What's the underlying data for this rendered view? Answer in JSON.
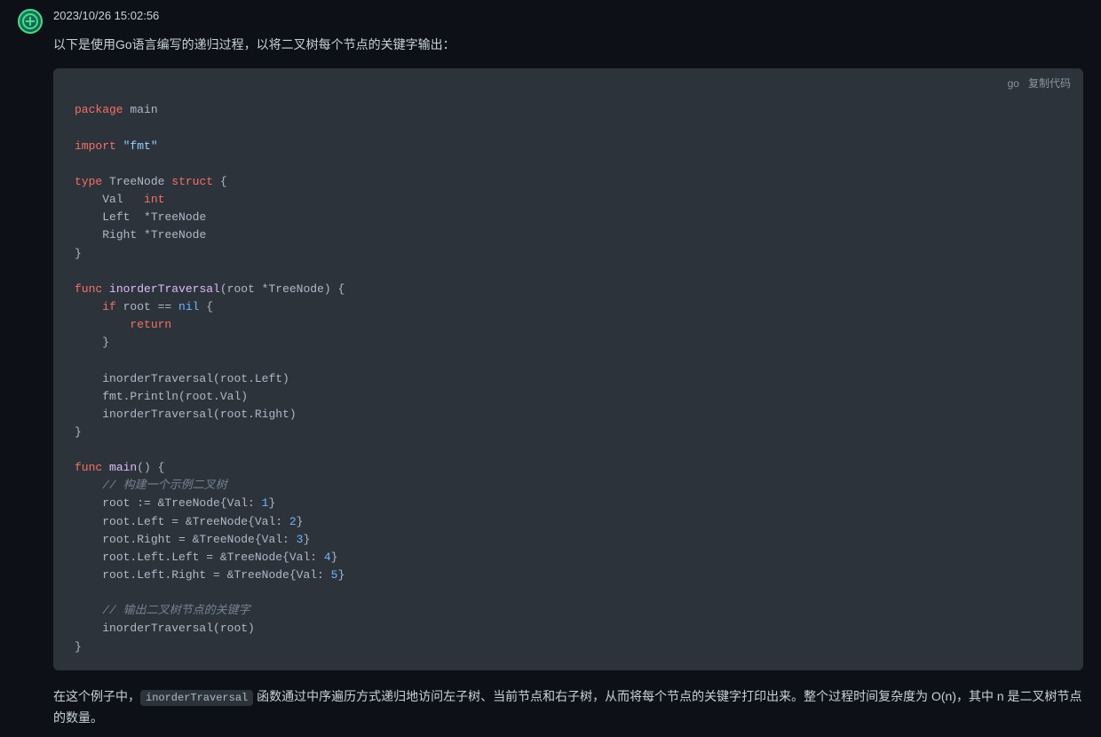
{
  "timestamp": "2023/10/26 15:02:56",
  "description": "以下是使用Go语言编写的递归过程，以将二叉树每个节点的关键字输出：",
  "code": {
    "language": "go",
    "copy_label": "复制代码",
    "tokens": {
      "package": "package",
      "main": "main",
      "import": "import",
      "fmt_str": "\"fmt\"",
      "type": "type",
      "treenode": "TreeNode",
      "struct": "struct",
      "val": "Val",
      "int": "int",
      "left": "Left",
      "ptr_treenode": "*TreeNode",
      "right": "Right",
      "func": "func",
      "inorder": "inorderTraversal",
      "root_param": "(root *TreeNode)",
      "if": "if",
      "root_eq": " root == ",
      "nil": "nil",
      "return": "return",
      "call_left": "inorderTraversal(root.Left)",
      "println": "fmt.Println(root.Val)",
      "call_right": "inorderTraversal(root.Right)",
      "main_fn": "main",
      "empty_parens": "()",
      "comment1": "// 构建一个示例二叉树",
      "root_assign": "root := &TreeNode{Val: ",
      "n1": "1",
      "close_brace": "}",
      "left_assign": "root.Left = &TreeNode{Val: ",
      "n2": "2",
      "right_assign": "root.Right = &TreeNode{Val: ",
      "n3": "3",
      "leftleft_assign": "root.Left.Left = &TreeNode{Val: ",
      "n4": "4",
      "leftright_assign": "root.Left.Right = &TreeNode{Val: ",
      "n5": "5",
      "comment2": "// 输出二叉树节点的关键字",
      "final_call": "inorderTraversal(root)"
    }
  },
  "footer": {
    "part1": "在这个例子中，",
    "inline_code": "inorderTraversal",
    "part2": " 函数通过中序遍历方式递归地访问左子树、当前节点和右子树，从而将每个节点的关键字打印出来。整个过程时间复杂度为 O(n)，其中 n 是二叉树节点的数量。"
  }
}
